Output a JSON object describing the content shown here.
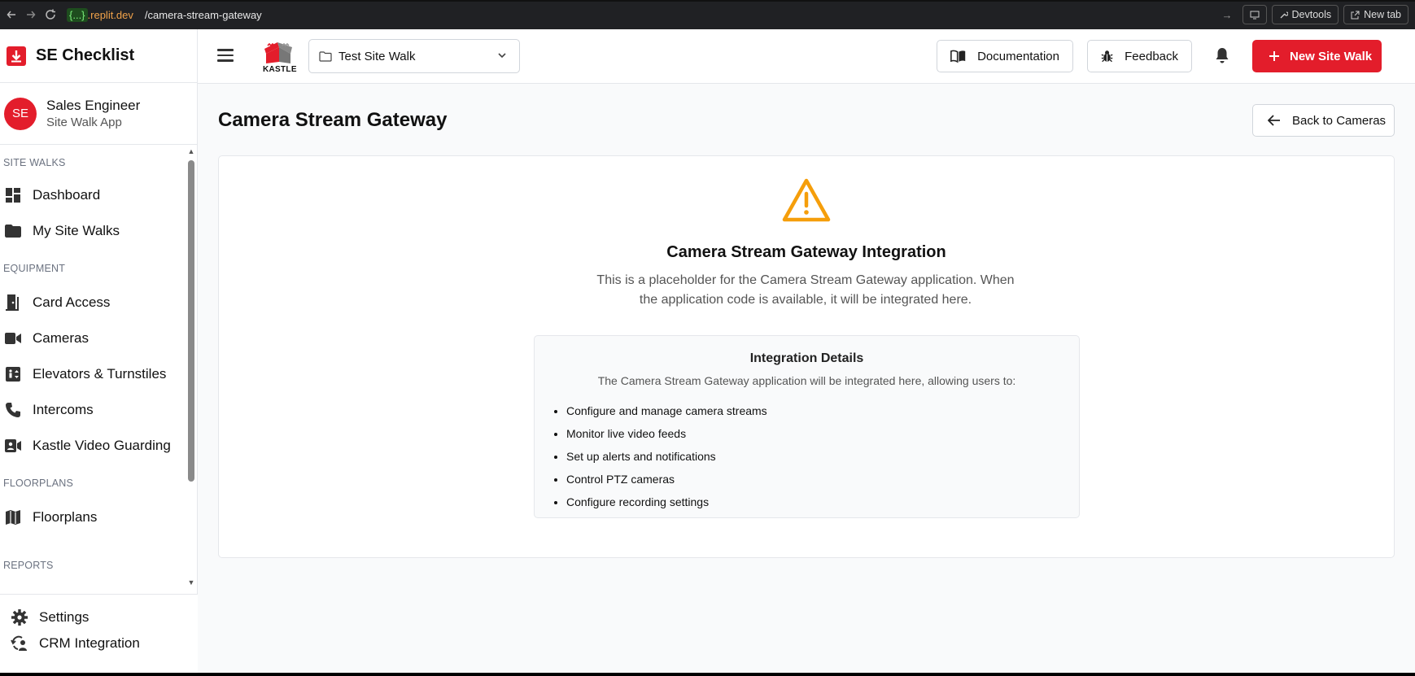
{
  "browser": {
    "url_badge": "{...}",
    "url_domain": ".replit.dev",
    "url_path": "/camera-stream-gateway",
    "devtools_label": "Devtools",
    "newtab_label": "New tab"
  },
  "sidebar": {
    "app_title": "SE Checklist",
    "user": {
      "initials": "SE",
      "name": "Sales Engineer",
      "role": "Site Walk App"
    },
    "sections": [
      {
        "label": "SITE WALKS",
        "items": [
          {
            "label": "Dashboard",
            "icon": "dashboard-icon"
          },
          {
            "label": "My Site Walks",
            "icon": "folder-icon"
          }
        ]
      },
      {
        "label": "EQUIPMENT",
        "items": [
          {
            "label": "Card Access",
            "icon": "door-icon"
          },
          {
            "label": "Cameras",
            "icon": "video-camera-icon"
          },
          {
            "label": "Elevators & Turnstiles",
            "icon": "elevator-icon"
          },
          {
            "label": "Intercoms",
            "icon": "phone-icon"
          },
          {
            "label": "Kastle Video Guarding",
            "icon": "video-guarding-icon"
          }
        ]
      },
      {
        "label": "FLOORPLANS",
        "items": [
          {
            "label": "Floorplans",
            "icon": "map-icon"
          }
        ]
      },
      {
        "label": "REPORTS",
        "items": []
      }
    ],
    "bottom_items": [
      {
        "label": "Settings",
        "icon": "gear-icon"
      },
      {
        "label": "CRM Integration",
        "icon": "crm-sync-icon"
      }
    ]
  },
  "header": {
    "brand_text": "KASTLE",
    "site_select_value": "Test Site Walk",
    "documentation_label": "Documentation",
    "feedback_label": "Feedback",
    "new_site_walk_label": "New Site Walk"
  },
  "main": {
    "page_title": "Camera Stream Gateway",
    "back_label": "Back to Cameras",
    "card_title": "Camera Stream Gateway Integration",
    "card_description": "This is a placeholder for the Camera Stream Gateway application. When the application code is available, it will be integrated here.",
    "details": {
      "title": "Integration Details",
      "intro": "The Camera Stream Gateway application will be integrated here, allowing users to:",
      "items": [
        "Configure and manage camera streams",
        "Monitor live video feeds",
        "Set up alerts and notifications",
        "Control PTZ cameras",
        "Configure recording settings"
      ]
    }
  },
  "colors": {
    "accent": "#e31d2b",
    "warning": "#f59e0b"
  }
}
